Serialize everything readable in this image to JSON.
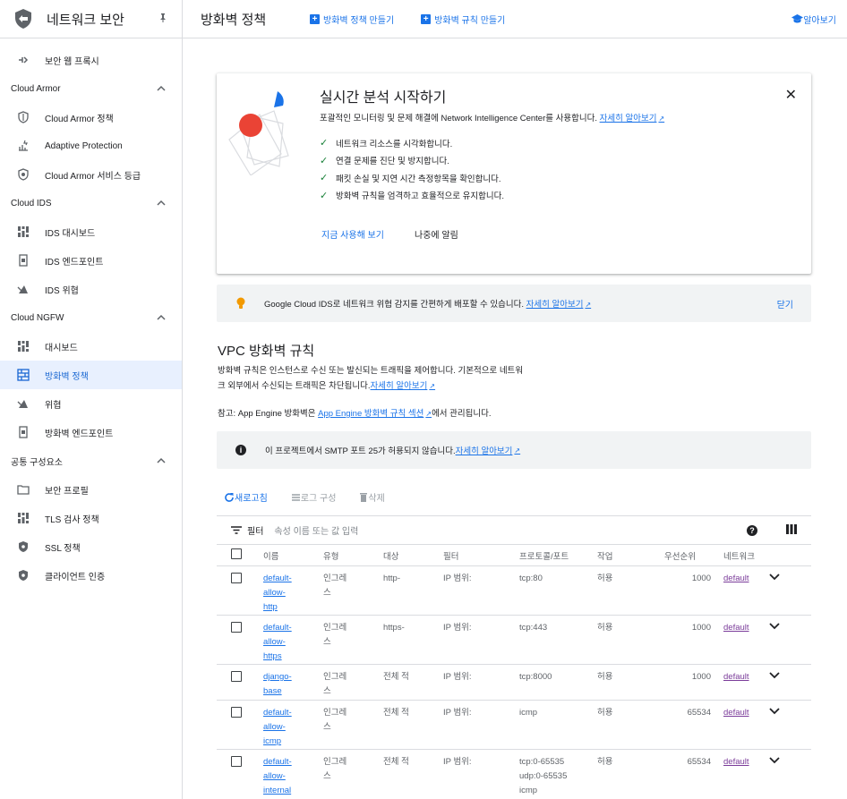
{
  "sidebar": {
    "title": "네트워크 보안",
    "top_item": "보안 웹 프록시",
    "sections": [
      {
        "label": "Cloud Armor",
        "items": [
          "Cloud Armor 정책",
          "Adaptive Protection",
          "Cloud Armor 서비스 등급"
        ]
      },
      {
        "label": "Cloud IDS",
        "items": [
          "IDS 대시보드",
          "IDS 엔드포인트",
          "IDS 위협"
        ]
      },
      {
        "label": "Cloud NGFW",
        "items": [
          "대시보드",
          "방화벽 정책",
          "위협",
          "방화벽 엔드포인트"
        ]
      },
      {
        "label": "공통 구성요소",
        "items": [
          "보안 프로필",
          "TLS 검사 정책",
          "SSL 정책",
          "클라이언트 인증"
        ]
      }
    ],
    "active_item": "방화벽 정책"
  },
  "topbar": {
    "page_title": "방화벽 정책",
    "create_policy": "방화벽 정책 만들기",
    "create_rule": "방화벽 규칙 만들기",
    "learn": "알아보기"
  },
  "card": {
    "title": "실시간 분석 시작하기",
    "subtitle": "포괄적인 모니터링 및 문제 해결에 Network Intelligence Center를 사용합니다.",
    "subtitle_link": "자세히 알아보기",
    "checks": [
      "네트워크 리소스를 시각화합니다.",
      "연결 문제를 진단 및 방지합니다.",
      "패킷 손실 및 지연 시간 측정항목을 확인합니다.",
      "방화벽 규칙을 엄격하고 효율적으로 유지합니다."
    ],
    "try_now": "지금 사용해 보기",
    "remind_later": "나중에 알림"
  },
  "ids_banner": {
    "text": "Google Cloud IDS로 네트워크 위협 감지를 간편하게 배포할 수 있습니다.",
    "link": "자세히 알아보기",
    "dismiss": "닫기"
  },
  "vpc": {
    "title": "VPC 방화벽 규칙",
    "desc_line1": "방화벽 규칙은 인스턴스로 수신 또는 발신되는 트래픽을 제어합니다. 기본적으로 네트워",
    "desc_line2": "크 외부에서 수신되는 트래픽은 차단됩니다.",
    "desc_link": "자세히 알아보기",
    "note_prefix": "참고: App Engine 방화벽은",
    "note_link": "App Engine 방화벽 규칙 섹션",
    "note_suffix": "에서 관리됩니다."
  },
  "smtp_banner": {
    "text": "이 프로젝트에서 SMTP 포트 25가 허용되지 않습니다.",
    "link": "자세히 알아보기"
  },
  "actions": {
    "refresh": "새로고침",
    "log_config": "로그 구성",
    "delete": "삭제"
  },
  "filter": {
    "label": "필터",
    "placeholder": "속성 이름 또는 값 입력"
  },
  "table": {
    "headers": [
      "이름",
      "유형",
      "대상",
      "필터",
      "프로토콜/포트",
      "작업",
      "우선순위",
      "네트워크"
    ],
    "rows": [
      {
        "name": [
          "default-",
          "allow-",
          "http"
        ],
        "type": [
          "인그레",
          "스"
        ],
        "target": "http-",
        "filter": "IP 범위:",
        "proto": [
          "tcp:80"
        ],
        "action": "허용",
        "priority": "1000",
        "network": "default"
      },
      {
        "name": [
          "default-",
          "allow-",
          "https"
        ],
        "type": [
          "인그레",
          "스"
        ],
        "target": "https-",
        "filter": "IP 범위:",
        "proto": [
          "tcp:443"
        ],
        "action": "허용",
        "priority": "1000",
        "network": "default"
      },
      {
        "name": [
          "django-",
          "base"
        ],
        "type": [
          "인그레",
          "스"
        ],
        "target": "전체 적",
        "filter": "IP 범위:",
        "proto": [
          "tcp:8000"
        ],
        "action": "허용",
        "priority": "1000",
        "network": "default"
      },
      {
        "name": [
          "default-",
          "allow-",
          "icmp"
        ],
        "type": [
          "인그레",
          "스"
        ],
        "target": "전체 적",
        "filter": "IP 범위:",
        "proto": [
          "icmp"
        ],
        "action": "허용",
        "priority": "65534",
        "network": "default"
      },
      {
        "name": [
          "default-",
          "allow-",
          "internal"
        ],
        "type": [
          "인그레",
          "스"
        ],
        "target": "전체 적",
        "filter": "IP 범위:",
        "proto": [
          "tcp:0-65535",
          "udp:0-65535",
          "icmp"
        ],
        "action": "허용",
        "priority": "65534",
        "network": "default"
      }
    ]
  }
}
